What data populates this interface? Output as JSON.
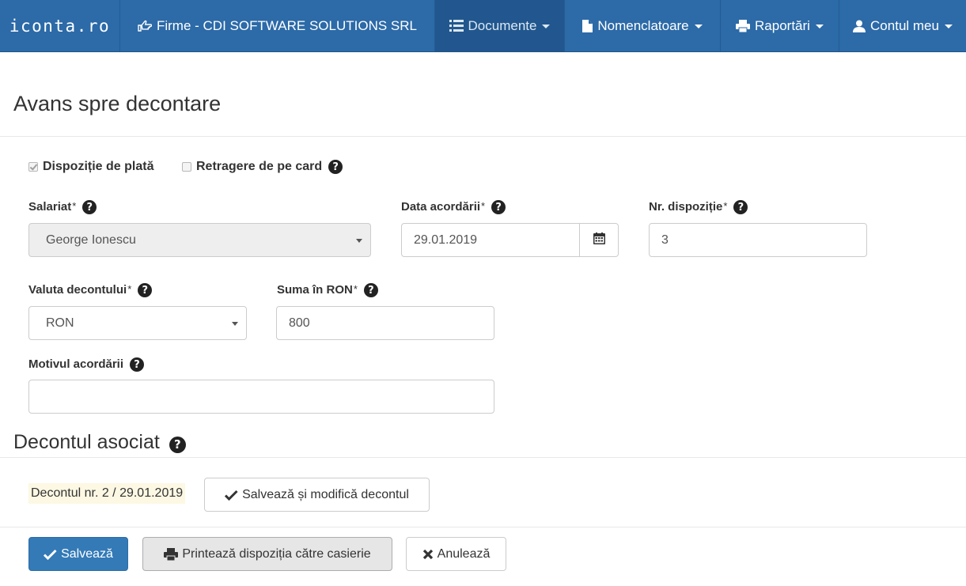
{
  "navbar": {
    "brand": "iconta.ro",
    "items": [
      {
        "label": "Firme - CDI SOFTWARE SOLUTIONS SRL",
        "icon": "hand-point-right-icon"
      },
      {
        "label": "Documente",
        "icon": "list-icon",
        "active": true
      },
      {
        "label": "Nomenclatoare",
        "icon": "file-icon"
      },
      {
        "label": "Raportări",
        "icon": "print-icon"
      },
      {
        "label": "Contul meu",
        "icon": "user-icon"
      }
    ]
  },
  "page": {
    "title": "Avans spre decontare"
  },
  "options": {
    "dispozitie_label": "Dispoziție de plată",
    "dispozitie_checked": true,
    "retragere_label": "Retragere de pe card",
    "retragere_checked": false
  },
  "form": {
    "required_mark": "*",
    "salariat": {
      "label": "Salariat",
      "value": "George Ionescu"
    },
    "data_acordarii": {
      "label": "Data acordării",
      "value": "29.01.2019"
    },
    "nr_dispozitie": {
      "label": "Nr. dispoziție",
      "value": "3"
    },
    "valuta": {
      "label": "Valuta decontului",
      "value": "RON"
    },
    "suma": {
      "label": "Suma în RON",
      "value": "800"
    },
    "motivul": {
      "label": "Motivul acordării",
      "value": ""
    }
  },
  "decont": {
    "section_title": "Decontul asociat",
    "badge": "Decontul nr. 2 / 29.01.2019",
    "save_modify_label": "Salvează și modifică decontul"
  },
  "footer": {
    "save_label": "Salvează",
    "print_label": "Printează dispoziția către casierie",
    "cancel_label": "Anulează"
  },
  "colors": {
    "navbar": "#2c6aa8",
    "navbar_active": "#21578e",
    "primary": "#337ab7",
    "badge_bg": "#fcf8e3"
  }
}
